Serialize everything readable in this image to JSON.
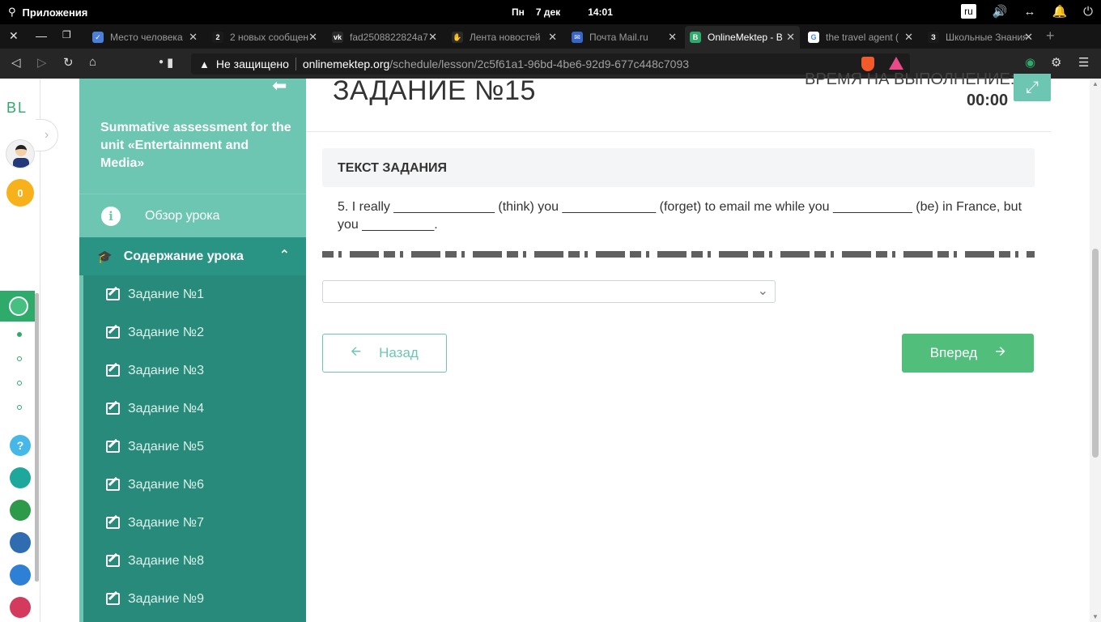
{
  "os": {
    "apps_label": "Приложения",
    "day": "Пн",
    "date": "7 дек",
    "time": "14:01",
    "lang": "ru"
  },
  "tabs": [
    {
      "label": "Место человека",
      "color": "#4a80d9",
      "glyph": "✓"
    },
    {
      "label": "2 новых сообщен",
      "color": "#1b1b1b",
      "glyph": "2"
    },
    {
      "label": "fad2508822824a7",
      "color": "#2a2a2a",
      "glyph": "vk"
    },
    {
      "label": "Лента новостей",
      "color": "#2a2a2a",
      "glyph": "✋"
    },
    {
      "label": "Почта Mail.ru",
      "color": "#3766c9",
      "glyph": "✉"
    },
    {
      "label": "OnlineMektep - B",
      "color": "#2eaa6a",
      "glyph": "B",
      "active": true
    },
    {
      "label": "the travel agent (",
      "color": "#ffffff",
      "glyph": "G"
    },
    {
      "label": "Школьные Знания",
      "color": "#1b1b1b",
      "glyph": "З"
    }
  ],
  "address": {
    "insecure": "Не защищено",
    "host": "onlinemektep.org",
    "path": "/schedule/lesson/2c5f61a1-96bd-4be6-92d9-677c448c7093"
  },
  "left": {
    "logo": "BL",
    "coins": "0",
    "help": "?"
  },
  "sidebar": {
    "course_title": "Summative assessment for the unit «Entertainment and Media»",
    "overview": "Обзор урока",
    "content": "Содержание урока",
    "tasks": [
      "Задание №1",
      "Задание №2",
      "Задание №3",
      "Задание №4",
      "Задание №5",
      "Задание №6",
      "Задание №7",
      "Задание №8",
      "Задание №9"
    ]
  },
  "main": {
    "title": "ЗАДАНИЕ №15",
    "time_label": "ВРЕМЯ НА ВЫПОЛНЕНИЕ:",
    "time_value": "00:00",
    "task_text_label": "ТЕКСТ ЗАДАНИЯ",
    "question": "5. I really ______________ (think) you _____________ (forget) to email me while you ___________ (be) in France, but you __________.",
    "select_value": "",
    "back": "Назад",
    "next": "Вперед"
  },
  "colors": {
    "sidebar": "#6cc6b1",
    "sidebar_dark": "#278a7b",
    "accent_green": "#52be7c"
  }
}
